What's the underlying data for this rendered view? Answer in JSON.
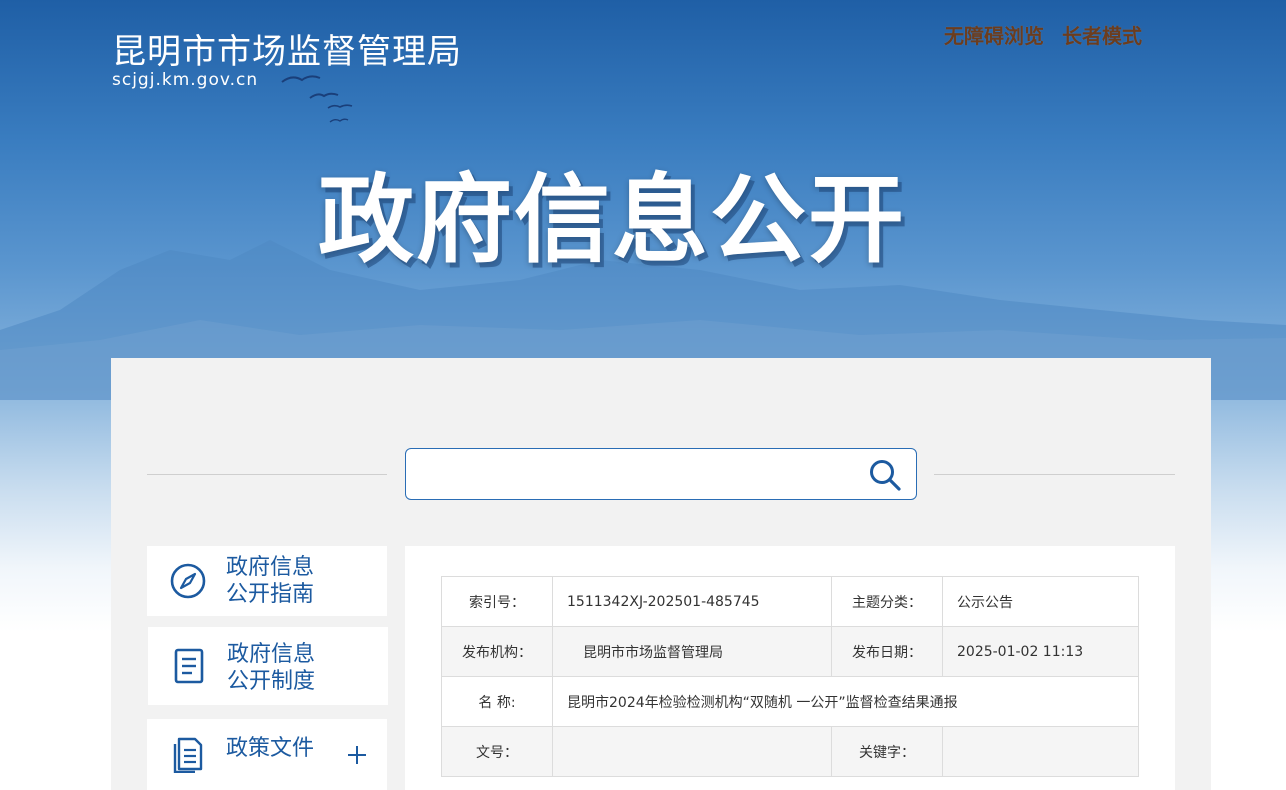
{
  "header": {
    "site_title": "昆明市市场监督管理局",
    "site_domain": "scjgj.km.gov.cn",
    "links": [
      "无障碍浏览",
      "长者模式"
    ]
  },
  "banner": {
    "title": "政府信息公开"
  },
  "search": {
    "placeholder": "",
    "value": ""
  },
  "sidebar": {
    "items": [
      {
        "label_line1": "政府信息",
        "label_line2": "公开指南",
        "icon": "compass-icon"
      },
      {
        "label_line1": "政府信息",
        "label_line2": "公开制度",
        "icon": "document-icon"
      },
      {
        "label_line1": "政策文件",
        "label_line2": "",
        "icon": "files-icon",
        "expand": "plus-icon"
      }
    ]
  },
  "meta_table": {
    "index_label": "索引号：",
    "index_value": "1511342XJ-202501-485745",
    "topic_label": "主题分类：",
    "topic_value": "公示公告",
    "publisher_label": "发布机构：",
    "publisher_value": "昆明市市场监督管理局",
    "date_label": "发布日期：",
    "date_value": "2025-01-02 11:13",
    "name_label": "名  称:",
    "name_value": "昆明市2024年检验检测机构“双随机 一公开”监督检查结果通报",
    "docno_label": "文号：",
    "docno_value": "",
    "keyword_label": "关键字：",
    "keyword_value": ""
  },
  "colors": {
    "accent": "#1c5aa0",
    "link_brown": "#6b3d1f",
    "panel_bg": "#f2f2f2"
  }
}
